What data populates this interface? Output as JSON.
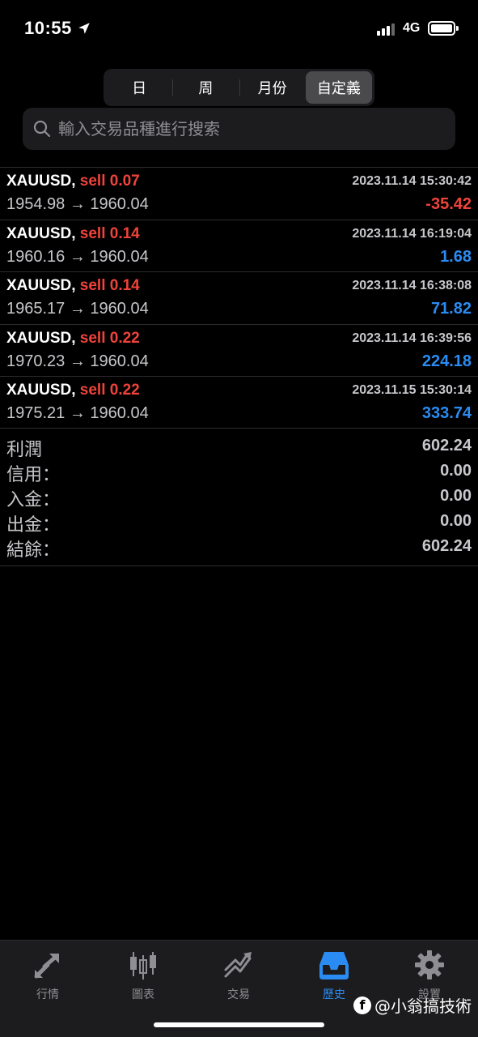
{
  "status_bar": {
    "time": "10:55",
    "network": "4G"
  },
  "segments": [
    {
      "label": "日"
    },
    {
      "label": "周"
    },
    {
      "label": "月份"
    },
    {
      "label": "自定義",
      "active": true
    }
  ],
  "search": {
    "placeholder": "輸入交易品種進行搜索"
  },
  "trades": [
    {
      "symbol": "XAUUSD,",
      "side": "sell 0.07",
      "timestamp": "2023.11.14 15:30:42",
      "prices": "1954.98 → 1960.04",
      "profit": "-35.42"
    },
    {
      "symbol": "XAUUSD,",
      "side": "sell 0.14",
      "timestamp": "2023.11.14 16:19:04",
      "prices": "1960.16 → 1960.04",
      "profit": "1.68"
    },
    {
      "symbol": "XAUUSD,",
      "side": "sell 0.14",
      "timestamp": "2023.11.14 16:38:08",
      "prices": "1965.17 → 1960.04",
      "profit": "71.82"
    },
    {
      "symbol": "XAUUSD,",
      "side": "sell 0.22",
      "timestamp": "2023.11.14 16:39:56",
      "prices": "1970.23 → 1960.04",
      "profit": "224.18"
    },
    {
      "symbol": "XAUUSD,",
      "side": "sell 0.22",
      "timestamp": "2023.11.15 15:30:14",
      "prices": "1975.21 → 1960.04",
      "profit": "333.74"
    }
  ],
  "summary": [
    {
      "label": "利潤",
      "value": "602.24"
    },
    {
      "label": "信用：",
      "value": "0.00"
    },
    {
      "label": "入金：",
      "value": "0.00"
    },
    {
      "label": "出金：",
      "value": "0.00"
    },
    {
      "label": "結餘：",
      "value": "602.24"
    }
  ],
  "tabs": [
    {
      "label": "行情",
      "icon": "quotes-icon"
    },
    {
      "label": "圖表",
      "icon": "chart-icon"
    },
    {
      "label": "交易",
      "icon": "trade-icon"
    },
    {
      "label": "歷史",
      "icon": "history-icon",
      "active": true
    },
    {
      "label": "設置",
      "icon": "settings-icon"
    }
  ],
  "watermark": {
    "text": "@小翁搞技術"
  },
  "colors": {
    "sell": "#f0433a",
    "profit_positive": "#2a8cf3",
    "profit_negative": "#f0433a",
    "active_tab": "#2a8cf3"
  }
}
